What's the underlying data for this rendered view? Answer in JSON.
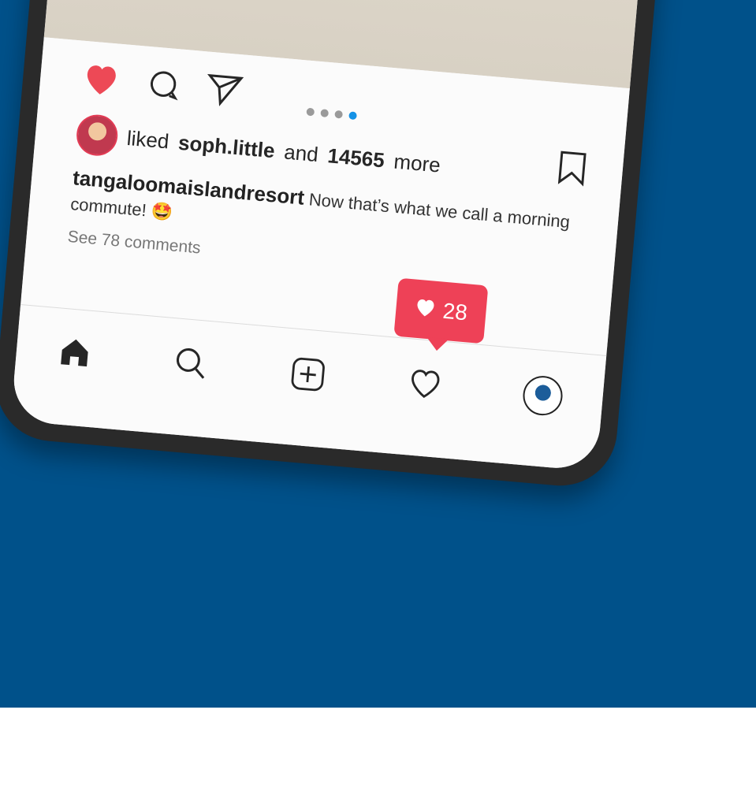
{
  "post": {
    "likes": {
      "prefix": "liked",
      "user": "soph.little",
      "and": "and",
      "count": "14565",
      "suffix": "more"
    },
    "caption": {
      "handle": "tangaloomaislandresort",
      "text": "Now that’s what we call a morning commute! 🤩"
    },
    "comments_link": "See 78 comments",
    "carousel": {
      "total": 4,
      "active": 4
    }
  },
  "notification": {
    "count": "28"
  },
  "icons": {
    "like": "heart-filled-icon",
    "comment": "comment-icon",
    "share": "send-icon",
    "save": "bookmark-icon",
    "home": "home-icon",
    "search": "search-icon",
    "add": "add-post-icon",
    "activity": "heart-outline-icon",
    "profile": "profile-avatar"
  },
  "colors": {
    "background": "#00518a",
    "like": "#ed4956",
    "active_dot": "#1592e6",
    "notification": "#ee4157"
  }
}
